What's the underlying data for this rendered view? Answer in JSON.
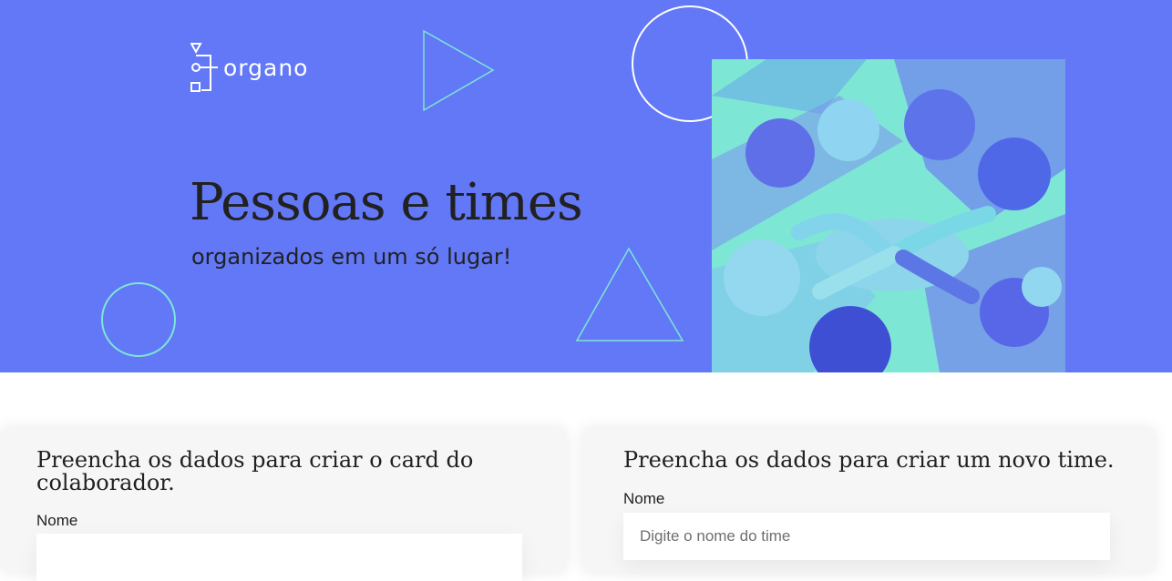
{
  "brand": {
    "name": "organo"
  },
  "hero": {
    "title": "Pessoas e times",
    "subtitle": "organizados em um só lugar!",
    "background_color": "#6278f7",
    "accent_color": "#7ee6d4",
    "photo_icon": "team-hands-photo"
  },
  "forms": {
    "collaborator": {
      "heading": "Preencha os dados para criar o card do colaborador.",
      "name_label": "Nome",
      "name_value": "",
      "name_placeholder": ""
    },
    "team": {
      "heading": "Preencha os dados para criar um novo time.",
      "name_label": "Nome",
      "name_value": "",
      "name_placeholder": "Digite o nome do time"
    }
  }
}
